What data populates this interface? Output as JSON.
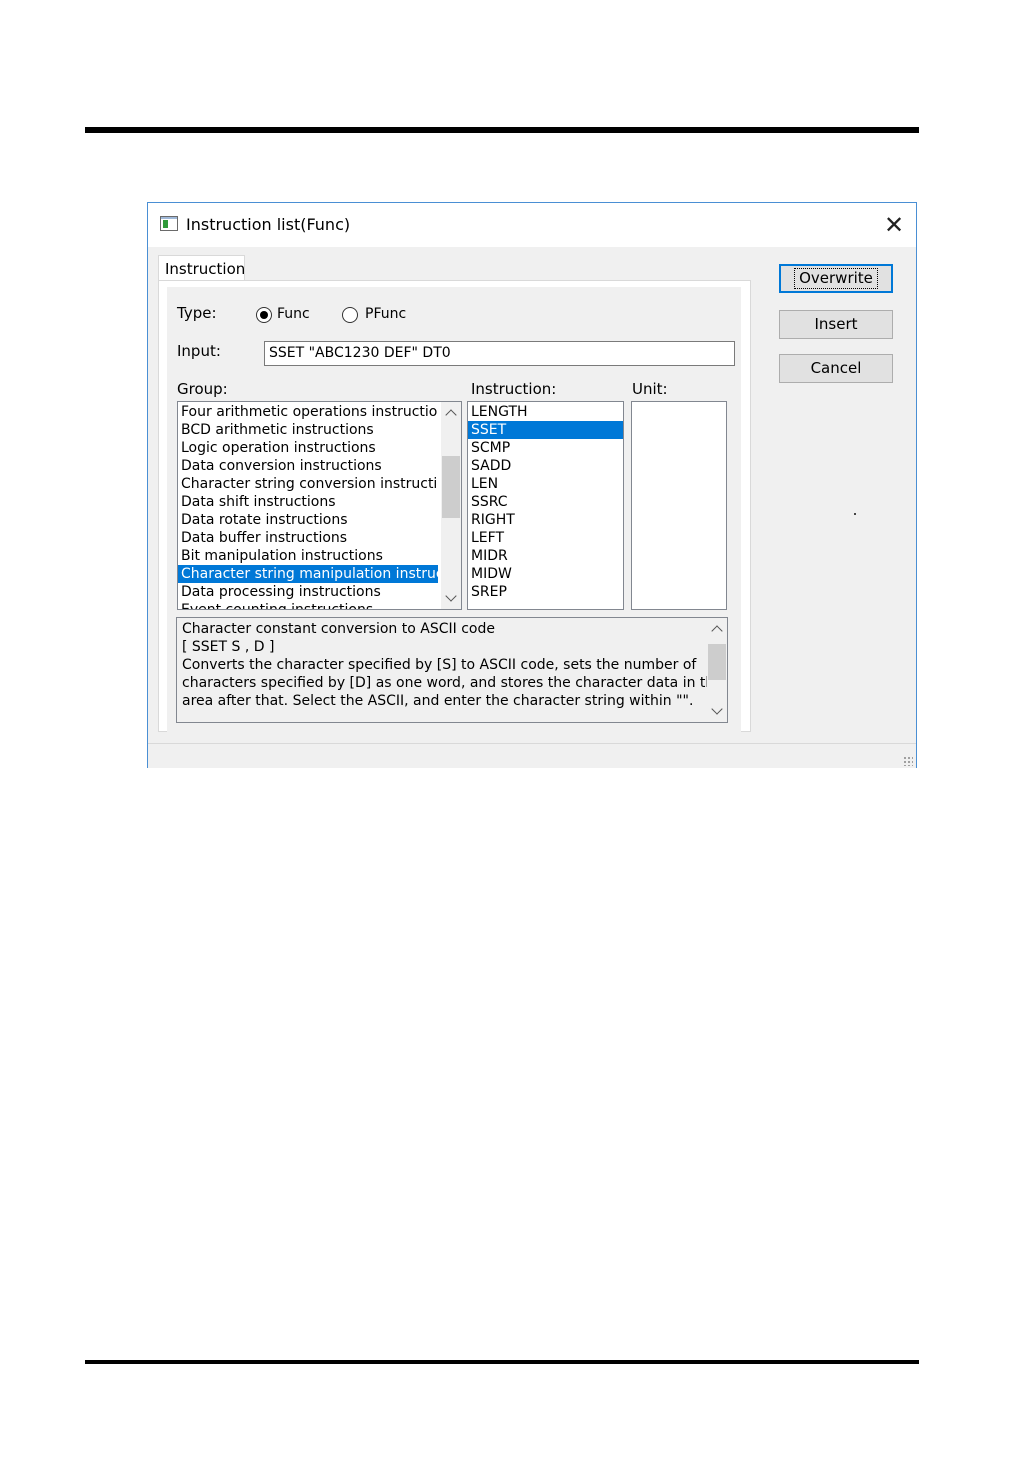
{
  "dialog": {
    "title": "Instruction list(Func)",
    "tab_label": "Instruction",
    "type_label": "Type:",
    "type_options": [
      {
        "label": "Func",
        "selected": true
      },
      {
        "label": "PFunc",
        "selected": false
      }
    ],
    "input_label": "Input:",
    "input_value": "SSET \"ABC1230 DEF\" DT0",
    "group_label": "Group:",
    "instruction_label": "Instruction:",
    "unit_label": "Unit:",
    "groups": [
      "Four arithmetic operations instructions",
      "BCD arithmetic instructions",
      "Logic operation instructions",
      "Data conversion instructions",
      "Character string conversion instruction",
      "Data shift instructions",
      "Data rotate instructions",
      "Data buffer instructions",
      "Bit manipulation instructions",
      "Character string manipulation instructi",
      "Data processing instructions",
      "Event counting instructions"
    ],
    "selected_group_index": 9,
    "instructions": [
      "LENGTH",
      "SSET",
      "SCMP",
      "SADD",
      "LEN",
      "SSRC",
      "RIGHT",
      "LEFT",
      "MIDR",
      "MIDW",
      "SREP"
    ],
    "selected_instruction_index": 1,
    "units": [],
    "description_lines": [
      "Character constant conversion to ASCII code",
      "[ SSET  S , D ]",
      "Converts the character specified by [S] to ASCII code, sets the number of",
      "characters specified by [D] as one word, and stores the character data in the",
      "area after that. Select the ASCII, and enter the character string within \"\"."
    ],
    "buttons": {
      "overwrite": "Overwrite",
      "insert": "Insert",
      "cancel": "Cancel"
    },
    "colors": {
      "selection": "#0078d7",
      "dialog_border": "#4a8fd4",
      "dialog_bg": "#f0f0f0"
    }
  }
}
